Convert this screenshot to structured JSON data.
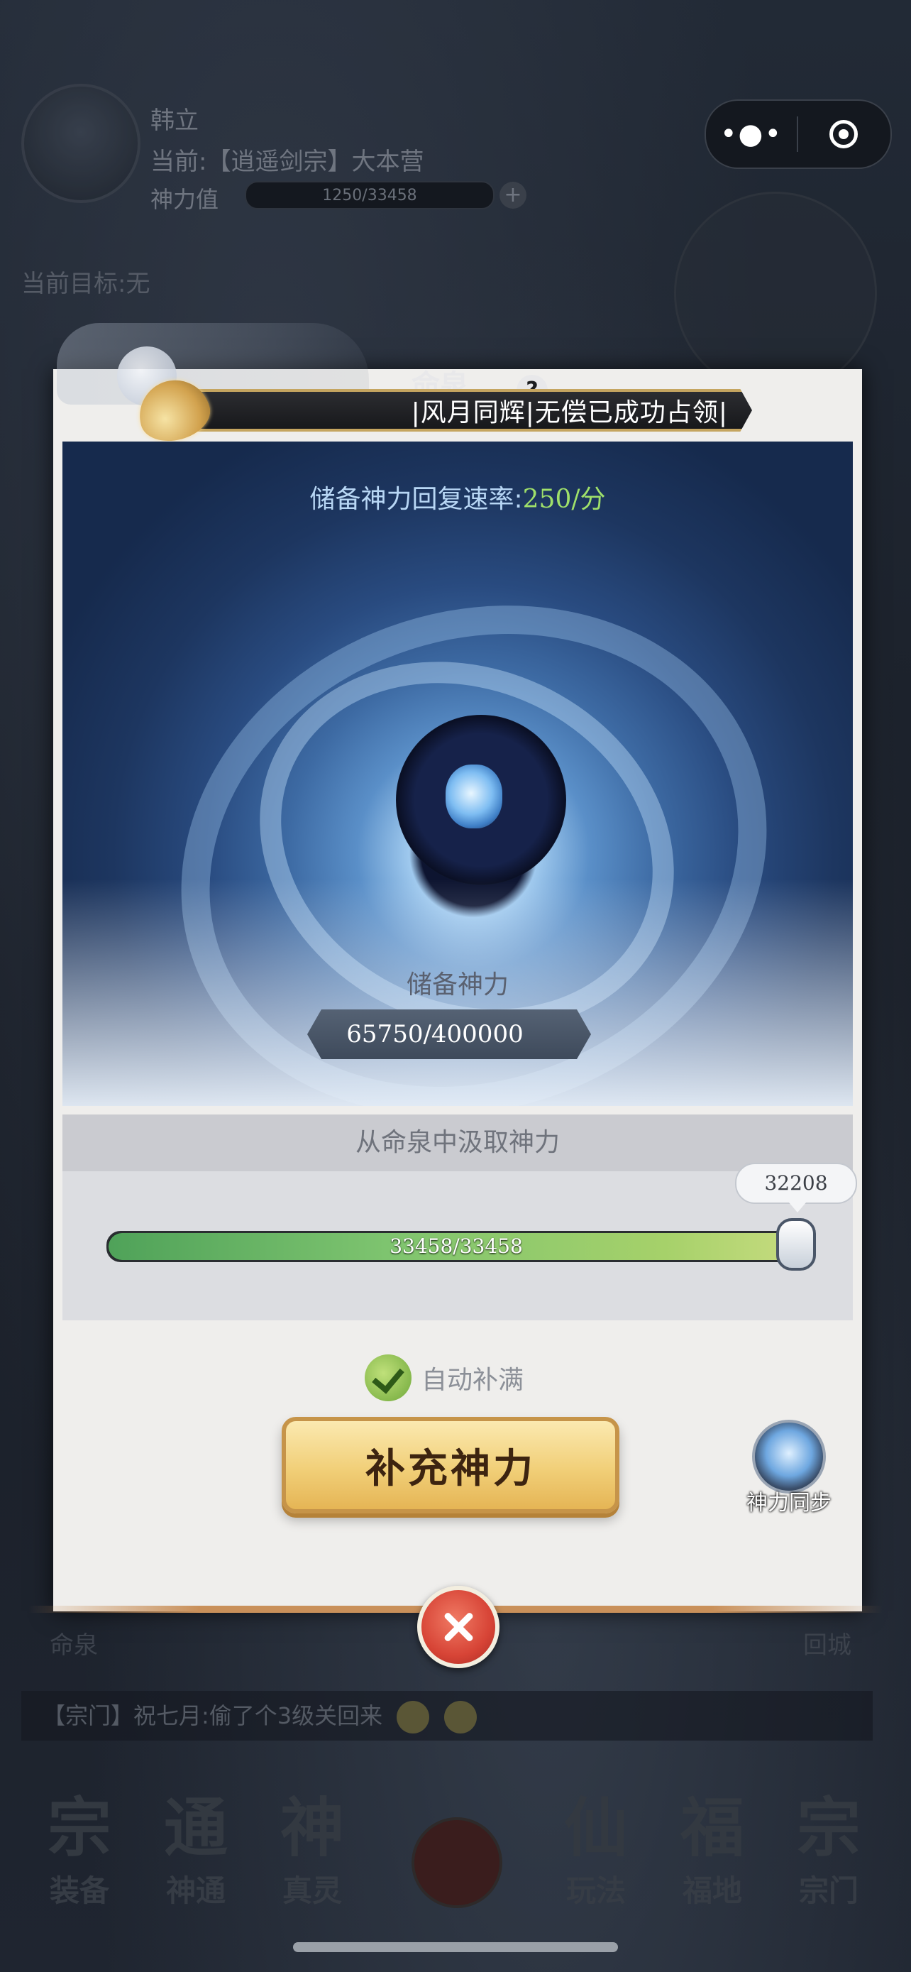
{
  "header": {
    "player_name": "韩立",
    "location": "当前:【逍遥剑宗】大本营",
    "power_label": "神力值",
    "power_value": "1250/33458",
    "target": "当前目标:无"
  },
  "modal": {
    "title": "命泉",
    "help_glyph": "?",
    "occupied_banner": "|风月同辉|无偿已成功占领|",
    "recovery_label": "储备神力回复速率:",
    "recovery_value": "250/分",
    "reserve_label": "储备神力",
    "reserve_value": "65750/400000",
    "draw_title": "从命泉中汲取神力",
    "draw_slider": {
      "text": "33458/33458",
      "fill_fraction": 1.0,
      "tooltip": "32208"
    },
    "auto_fill_label": "自动补满",
    "auto_fill_checked": true,
    "refill_button_label": "补充神力",
    "sync_label": "神力同步"
  },
  "background_labels": {
    "left": "命泉",
    "right": "回城",
    "chat": "【宗门】祝七月:偷了个3级关回来"
  },
  "bottom_nav": [
    {
      "glyph": "宗",
      "label": "装备"
    },
    {
      "glyph": "通",
      "label": "神通"
    },
    {
      "glyph": "神",
      "label": "真灵"
    },
    {
      "glyph": "仙",
      "label": "玩法"
    },
    {
      "glyph": "福",
      "label": "福地"
    },
    {
      "glyph": "宗",
      "label": "宗门"
    }
  ],
  "colors": {
    "accent_gold": "#f1cf78",
    "progress_green": "#7ec46f",
    "close_red": "#d74436"
  },
  "icons": [
    "more-icon",
    "target-icon",
    "horn-icon",
    "help-icon",
    "plus-icon",
    "check-icon",
    "sync-icon",
    "close-icon"
  ]
}
